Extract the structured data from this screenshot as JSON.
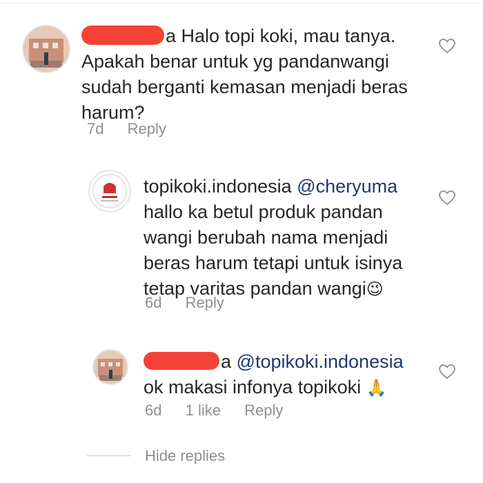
{
  "comments": [
    {
      "user_suffix": "a",
      "text_line1": " Halo topi koki, mau tanya.",
      "text_line2": "Apakah benar untuk yg pandanwangi",
      "text_line3": "sudah berganti kemasan menjadi beras",
      "text_line4": "harum?",
      "time": "7d",
      "reply_label": "Reply"
    },
    {
      "username": "topikoki.indonesia",
      "mention": "@cheryuma",
      "text_line2": "hallo ka betul produk pandan",
      "text_line3": "wangi berubah nama menjadi",
      "text_line4": "beras harum tetapi untuk isinya",
      "text_line5": "tetap varitas pandan wangi",
      "emoji": "😉",
      "time": "6d",
      "reply_label": "Reply"
    },
    {
      "user_suffix": "a",
      "mention": "@topikoki.indonesia",
      "text_line2": "ok makasi infonya topikoki",
      "emoji": "🙏",
      "time": "6d",
      "likes": "1 like",
      "reply_label": "Reply"
    }
  ],
  "hide_replies_label": "Hide replies",
  "colors": {
    "redaction": "#f44336",
    "meta": "#8e8e8e",
    "text": "#262626"
  }
}
